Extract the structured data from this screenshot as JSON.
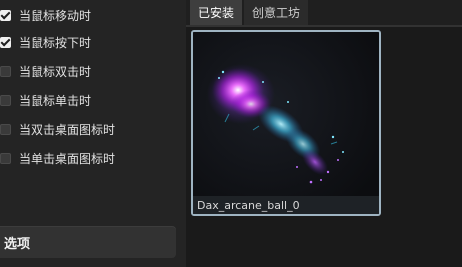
{
  "options": [
    {
      "label": "当鼠标移动时",
      "checked": true
    },
    {
      "label": "当鼠标按下时",
      "checked": true
    },
    {
      "label": "当鼠标双击时",
      "checked": false
    },
    {
      "label": "当鼠标单击时",
      "checked": false
    },
    {
      "label": "当双击桌面图标时",
      "checked": false
    },
    {
      "label": "当单击桌面图标时",
      "checked": false
    }
  ],
  "section": {
    "label": "选项"
  },
  "tabs": [
    {
      "label": "已安装",
      "active": true
    },
    {
      "label": "创意工坊",
      "active": false
    }
  ],
  "item": {
    "name": "Dax_arcane_ball_0"
  },
  "colors": {
    "accent_border": "#9fb4c2",
    "particle_primary": "#e040ff",
    "particle_secondary": "#40c8e8"
  }
}
